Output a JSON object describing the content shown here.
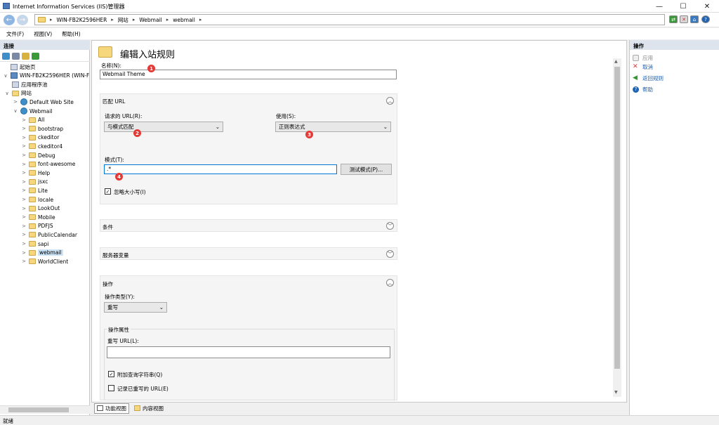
{
  "window": {
    "title": "Internet Information Services (IIS)管理器",
    "controls": [
      "—",
      "☐",
      "✕"
    ]
  },
  "address": {
    "crumbs": [
      "WIN-FB2K2596HER",
      "网站",
      "Webmail",
      "webmail"
    ]
  },
  "menu": {
    "items": [
      "文件(F)",
      "视图(V)",
      "帮助(H)"
    ]
  },
  "connections": {
    "header": "连接",
    "tree": [
      {
        "label": "起始页",
        "depth": 0,
        "icon": "page",
        "exp": ""
      },
      {
        "label": "WIN-FB2K2596HER (WIN-F",
        "depth": 0,
        "icon": "server",
        "exp": "∨"
      },
      {
        "label": "应用程序池",
        "depth": 1,
        "icon": "pool",
        "exp": ""
      },
      {
        "label": "网站",
        "depth": 1,
        "icon": "folder",
        "exp": "∨"
      },
      {
        "label": "Default Web Site",
        "depth": 2,
        "icon": "globe",
        "exp": ">"
      },
      {
        "label": "Webmail",
        "depth": 2,
        "icon": "globe",
        "exp": "∨"
      },
      {
        "label": "All",
        "depth": 3,
        "icon": "folder",
        "exp": ">"
      },
      {
        "label": "bootstrap",
        "depth": 3,
        "icon": "folder",
        "exp": ">"
      },
      {
        "label": "ckeditor",
        "depth": 3,
        "icon": "folder",
        "exp": ">"
      },
      {
        "label": "ckeditor4",
        "depth": 3,
        "icon": "folder",
        "exp": ">"
      },
      {
        "label": "Debug",
        "depth": 3,
        "icon": "folder",
        "exp": ">"
      },
      {
        "label": "font-awesome",
        "depth": 3,
        "icon": "folder",
        "exp": ">"
      },
      {
        "label": "Help",
        "depth": 3,
        "icon": "folder",
        "exp": ">"
      },
      {
        "label": "jsxc",
        "depth": 3,
        "icon": "folder",
        "exp": ">"
      },
      {
        "label": "Lite",
        "depth": 3,
        "icon": "folder",
        "exp": ">"
      },
      {
        "label": "locale",
        "depth": 3,
        "icon": "folder",
        "exp": ">"
      },
      {
        "label": "LookOut",
        "depth": 3,
        "icon": "folder",
        "exp": ">"
      },
      {
        "label": "Mobile",
        "depth": 3,
        "icon": "folder",
        "exp": ">"
      },
      {
        "label": "PDFJS",
        "depth": 3,
        "icon": "folder",
        "exp": ">"
      },
      {
        "label": "PublicCalendar",
        "depth": 3,
        "icon": "folder",
        "exp": ">"
      },
      {
        "label": "sapi",
        "depth": 3,
        "icon": "folder",
        "exp": ">"
      },
      {
        "label": "webmail",
        "depth": 3,
        "icon": "folder",
        "exp": ">",
        "selected": true
      },
      {
        "label": "WorldClient",
        "depth": 3,
        "icon": "folder",
        "exp": ">"
      }
    ]
  },
  "editor": {
    "title": "编辑入站规则",
    "name_label": "名称(N):",
    "name_value": "Webmail Theme",
    "match_url": {
      "header": "匹配 URL",
      "requested_url_label": "请求的 URL(R):",
      "requested_url_value": "与模式匹配",
      "using_label": "使用(S):",
      "using_value": "正则表达式",
      "pattern_label": "模式(T):",
      "pattern_value": ".*",
      "test_button": "测试模式(P)...",
      "ignore_case_label": "忽略大小写(I)",
      "ignore_case_checked": true
    },
    "conditions_header": "条件",
    "server_vars_header": "服务器变量",
    "action": {
      "header": "操作",
      "type_label": "操作类型(Y):",
      "type_value": "重写",
      "props_header": "操作属性",
      "rewrite_url_label": "重写 URL(L):",
      "rewrite_url_value": "",
      "append_query_label": "附加查询字符串(Q)",
      "append_query_checked": true,
      "log_rewritten_label": "记录已重写的 URL(E)",
      "log_rewritten_checked": false
    },
    "badges": [
      "1",
      "2",
      "3",
      "4"
    ]
  },
  "view_tabs": {
    "features": "功能视图",
    "content": "内容视图"
  },
  "actions": {
    "header": "操作",
    "items": [
      {
        "label": "应用",
        "enabled": false,
        "icon": "apply-icon"
      },
      {
        "label": "取消",
        "enabled": true,
        "icon": "cancel-icon"
      },
      {
        "label": "返回规则",
        "enabled": true,
        "icon": "back-icon"
      },
      {
        "label": "帮助",
        "enabled": true,
        "icon": "help-icon"
      }
    ]
  },
  "status": {
    "text": "就绪"
  },
  "colors": {
    "accent": "#0063b1",
    "badge": "#e53935",
    "link": "#1a5fb4",
    "disabled": "#8a8a8a"
  }
}
